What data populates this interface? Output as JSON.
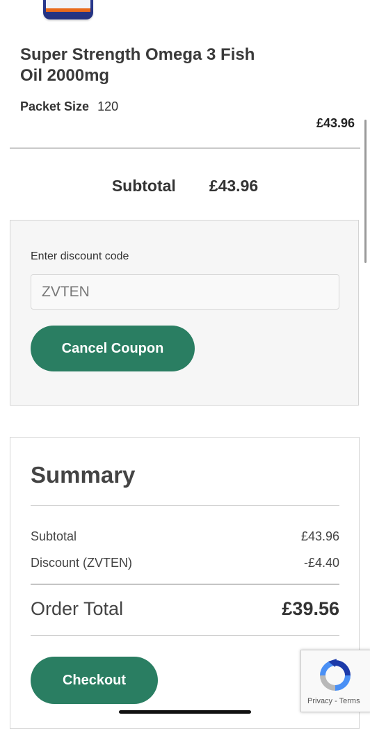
{
  "product": {
    "title": "Super Strength Omega 3 Fish Oil 2000mg",
    "packet_size_label": "Packet Size",
    "packet_size_value": "120",
    "price": "£43.96"
  },
  "cart": {
    "subtotal_label": "Subtotal",
    "subtotal_value": "£43.96"
  },
  "discount": {
    "label": "Enter discount code",
    "code": "ZVTEN",
    "cancel_button": "Cancel Coupon"
  },
  "summary": {
    "title": "Summary",
    "subtotal_label": "Subtotal",
    "subtotal_value": "£43.96",
    "discount_label": "Discount (ZVTEN)",
    "discount_value": "-£4.40",
    "total_label": "Order Total",
    "total_value": "£39.56",
    "checkout_button": "Checkout"
  },
  "recaptcha": {
    "links": "Privacy - Terms",
    "icon": "recaptcha-logo-icon"
  },
  "colors": {
    "accent": "#2a7e62",
    "panel": "#f6f6f6"
  }
}
